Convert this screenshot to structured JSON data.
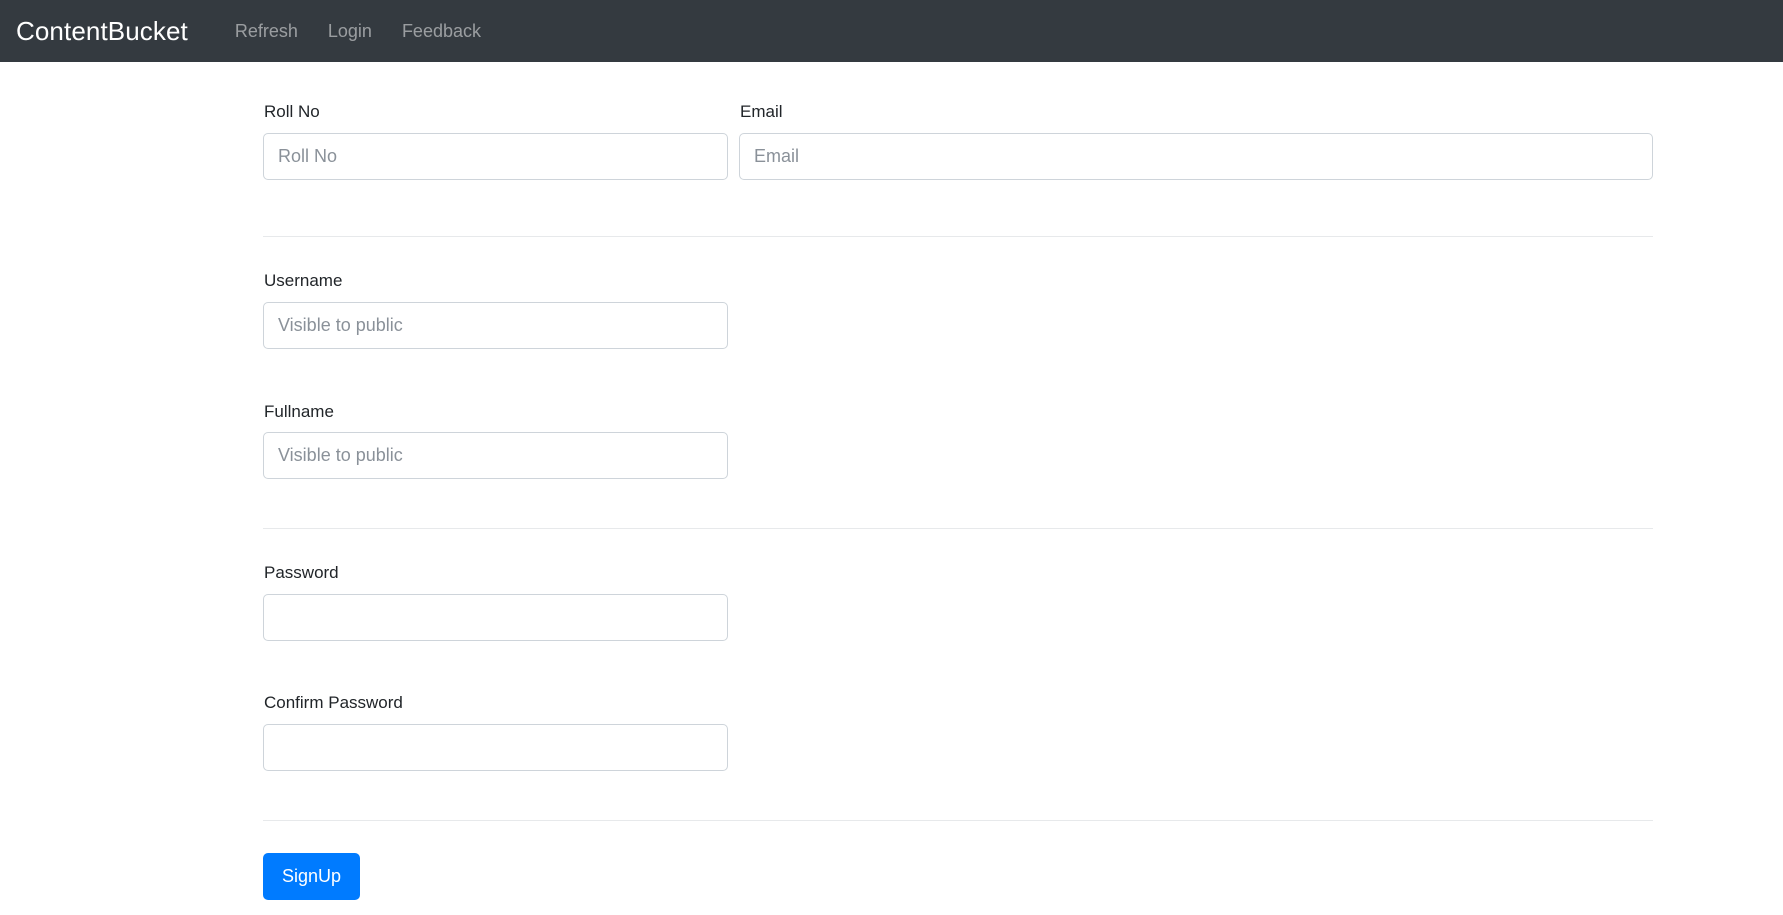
{
  "navbar": {
    "brand": "ContentBucket",
    "links": [
      {
        "label": "Refresh",
        "name": "nav-link-refresh"
      },
      {
        "label": "Login",
        "name": "nav-link-login"
      },
      {
        "label": "Feedback",
        "name": "nav-link-feedback"
      }
    ],
    "background_color": "#343a40",
    "brand_color": "#ffffff",
    "link_color": "rgba(255,255,255,0.5)"
  },
  "form": {
    "fields": {
      "roll_no": {
        "label": "Roll No",
        "placeholder": "Roll No",
        "value": "",
        "type": "text"
      },
      "email": {
        "label": "Email",
        "placeholder": "Email",
        "value": "",
        "type": "text"
      },
      "username": {
        "label": "Username",
        "placeholder": "Visible to public",
        "value": "",
        "type": "text"
      },
      "fullname": {
        "label": "Fullname",
        "placeholder": "Visible to public",
        "value": "",
        "type": "text"
      },
      "password": {
        "label": "Password",
        "placeholder": "",
        "value": "",
        "type": "password"
      },
      "confirm_password": {
        "label": "Confirm Password",
        "placeholder": "",
        "value": "",
        "type": "password"
      }
    },
    "submit": {
      "label": "SignUp",
      "color": "#ffffff",
      "background_color": "#007bff"
    },
    "divider_color": "#e7e9eb",
    "input_border_color": "#ced4da",
    "label_color": "#212529",
    "placeholder_color": "#8a9199"
  }
}
